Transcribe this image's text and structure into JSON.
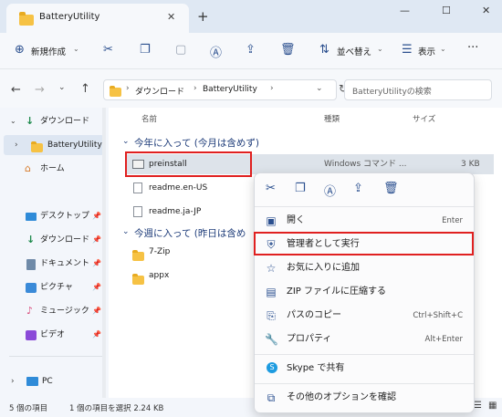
{
  "window": {
    "tab_title": "BatteryUtility",
    "new_tab": "+",
    "minimize": "—",
    "maximize": "☐",
    "close": "✕"
  },
  "toolbar": {
    "new_label": "新規作成",
    "sort_label": "並べ替え",
    "view_label": "表示",
    "more": "···"
  },
  "address": {
    "segments": [
      "ダウンロード",
      "BatteryUtility"
    ],
    "search_placeholder": "BatteryUtilityの検索"
  },
  "nav": {
    "items": [
      {
        "label": "ダウンロード"
      },
      {
        "label": "BatteryUtility"
      },
      {
        "label": "ホーム"
      },
      {
        "label": "デスクトップ"
      },
      {
        "label": "ダウンロード"
      },
      {
        "label": "ドキュメント"
      },
      {
        "label": "ピクチャ"
      },
      {
        "label": "ミュージック"
      },
      {
        "label": "ビデオ"
      },
      {
        "label": "PC"
      }
    ]
  },
  "columns": {
    "name": "名前",
    "type": "種類",
    "size": "サイズ"
  },
  "groups": [
    {
      "label": "今年に入って (今月は含めず)",
      "files": [
        {
          "name": "preinstall",
          "type": "Windows コマンド ...",
          "size": "3 KB"
        },
        {
          "name": "readme.en-US",
          "type": "",
          "size": ""
        },
        {
          "name": "readme.ja-JP",
          "type": "",
          "size": ""
        }
      ]
    },
    {
      "label": "今週に入って (昨日は含め",
      "files": [
        {
          "name": "7-Zip",
          "type": "",
          "size": ""
        },
        {
          "name": "appx",
          "type": "",
          "size": ""
        }
      ]
    }
  ],
  "status": {
    "count": "5 個の項目",
    "selection": "1 個の項目を選択  2.24 KB"
  },
  "context_menu": {
    "items": [
      {
        "label": "開く",
        "shortcut": "Enter"
      },
      {
        "label": "管理者として実行",
        "shortcut": ""
      },
      {
        "label": "お気に入りに追加",
        "shortcut": ""
      },
      {
        "label": "ZIP ファイルに圧縮する",
        "shortcut": ""
      },
      {
        "label": "パスのコピー",
        "shortcut": "Ctrl+Shift+C"
      },
      {
        "label": "プロパティ",
        "shortcut": "Alt+Enter"
      },
      {
        "label": "Skype で共有",
        "shortcut": ""
      },
      {
        "label": "その他のオプションを確認",
        "shortcut": ""
      }
    ]
  },
  "colors": {
    "highlight": "#e02020",
    "accent": "#2a4f8f",
    "folder": "#f6c244"
  }
}
